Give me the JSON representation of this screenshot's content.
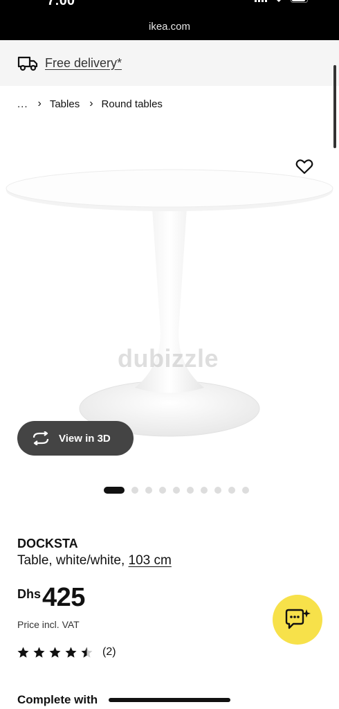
{
  "status_bar": {
    "time": "7:00"
  },
  "browser": {
    "url": "ikea.com"
  },
  "delivery": {
    "label": "Free delivery*"
  },
  "breadcrumb": {
    "ellipsis": "...",
    "items": [
      "Tables",
      "Round tables"
    ]
  },
  "gallery": {
    "watermark": "dubizzle",
    "view_3d_label": "View in 3D",
    "total_images": 10,
    "active_index": 0
  },
  "product": {
    "name": "DOCKSTA",
    "description": "Table, white/white,",
    "size_link": "103 cm",
    "currency": "Dhs",
    "price": "425",
    "price_note": "Price incl. VAT",
    "rating": 4.5,
    "rating_count": "(2)"
  },
  "section": {
    "complete_with": "Complete with"
  },
  "colors": {
    "chat_button": "#f7e14a",
    "view3d_button": "#444444",
    "delivery_bg": "#f5f5f5"
  }
}
